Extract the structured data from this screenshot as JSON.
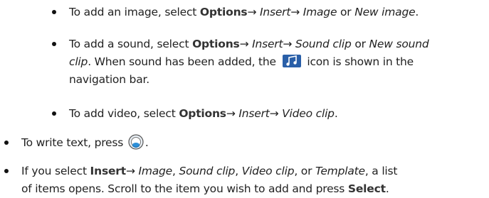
{
  "items": [
    {
      "id": "add-image",
      "segments": [
        {
          "t": "To add an image, select ",
          "s": ""
        },
        {
          "t": "Options",
          "s": "b"
        },
        {
          "t": "→ ",
          "s": ""
        },
        {
          "t": "Insert",
          "s": "i"
        },
        {
          "t": "→ ",
          "s": ""
        },
        {
          "t": "Image",
          "s": "i"
        },
        {
          "t": " or ",
          "s": ""
        },
        {
          "t": "New image",
          "s": "i"
        },
        {
          "t": ".",
          "s": ""
        }
      ]
    },
    {
      "id": "add-sound",
      "lines": [
        [
          {
            "t": "To add a sound, select ",
            "s": ""
          },
          {
            "t": "Options",
            "s": "b"
          },
          {
            "t": "→ ",
            "s": ""
          },
          {
            "t": "Insert",
            "s": "i"
          },
          {
            "t": "→ ",
            "s": ""
          },
          {
            "t": "Sound clip",
            "s": "i"
          },
          {
            "t": " or ",
            "s": ""
          },
          {
            "t": "New sound",
            "s": "i"
          }
        ],
        [
          {
            "t": "clip",
            "s": "i"
          },
          {
            "t": ". When sound has been added, the ",
            "s": ""
          },
          {
            "t": "ICON",
            "s": "icon"
          },
          {
            "t": " icon is shown in the",
            "s": ""
          }
        ],
        [
          {
            "t": "navigation bar.",
            "s": ""
          }
        ]
      ]
    },
    {
      "id": "add-video",
      "segments": [
        {
          "t": "To add video, select ",
          "s": ""
        },
        {
          "t": "Options",
          "s": "b"
        },
        {
          "t": "→ ",
          "s": ""
        },
        {
          "t": "Insert",
          "s": "i"
        },
        {
          "t": "→ ",
          "s": ""
        },
        {
          "t": "Video clip",
          "s": "i"
        },
        {
          "t": ".",
          "s": ""
        }
      ]
    },
    {
      "id": "write-text",
      "segments": [
        {
          "t": "To write text, press ",
          "s": ""
        },
        {
          "t": "NAV",
          "s": "nav"
        },
        {
          "t": ".",
          "s": ""
        }
      ]
    },
    {
      "id": "select-insert",
      "lines": [
        [
          {
            "t": "If you select ",
            "s": ""
          },
          {
            "t": "Insert",
            "s": "b"
          },
          {
            "t": "→ ",
            "s": ""
          },
          {
            "t": "Image",
            "s": "i"
          },
          {
            "t": ", ",
            "s": ""
          },
          {
            "t": "Sound clip",
            "s": "i"
          },
          {
            "t": ", ",
            "s": ""
          },
          {
            "t": "Video clip",
            "s": "i"
          },
          {
            "t": ", or ",
            "s": ""
          },
          {
            "t": "Template",
            "s": "i"
          },
          {
            "t": ", a list",
            "s": ""
          }
        ],
        [
          {
            "t": "of items opens. Scroll to the item you wish to add and press ",
            "s": ""
          },
          {
            "t": "Select",
            "s": "b"
          },
          {
            "t": ".",
            "s": ""
          }
        ]
      ]
    }
  ],
  "icons": {
    "sound_icon": "sound-clip-icon",
    "nav_icon": "scroll-key-icon",
    "sound_icon_color": "#2a5fa8"
  }
}
